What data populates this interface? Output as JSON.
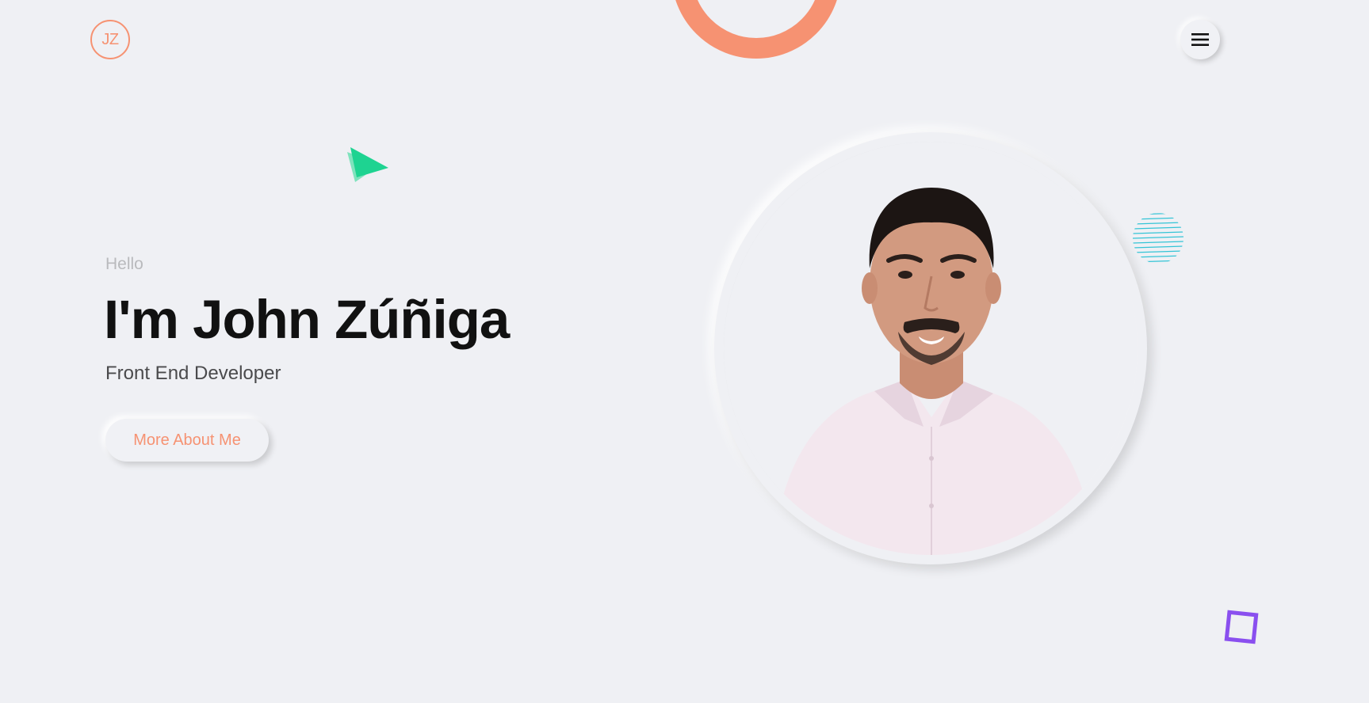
{
  "header": {
    "logo_text": "JZ",
    "menu_icon": "hamburger-icon"
  },
  "hero": {
    "greeting": "Hello",
    "name": "I'm John Zúñiga",
    "role": "Front End Developer",
    "cta_label": "More About Me"
  },
  "profile": {
    "photo_icon": "profile-photo"
  },
  "colors": {
    "accent": "#f69272",
    "background": "#eff0f4",
    "triangle": "#1ed391",
    "stripes": "#33c4d6",
    "square": "#8a4fef",
    "heading": "#111111"
  }
}
